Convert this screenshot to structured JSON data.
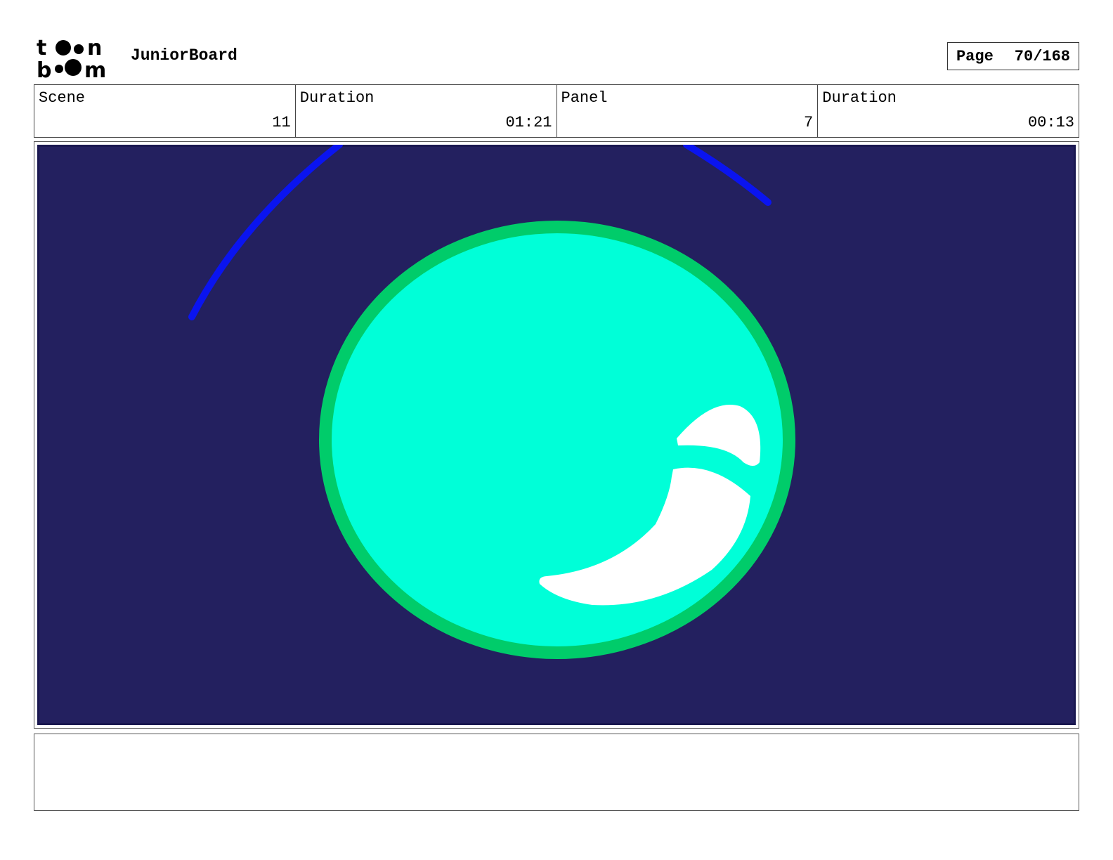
{
  "header": {
    "logo_top": "t●●n",
    "logo_bottom": "b●●m",
    "app_name": "JuniorBoard",
    "page_label": "Page",
    "page_value": "70/168"
  },
  "info": {
    "scene_label": "Scene",
    "scene_value": "11",
    "scene_duration_label": "Duration",
    "scene_duration_value": "01:21",
    "panel_label": "Panel",
    "panel_value": "7",
    "panel_duration_label": "Duration",
    "panel_duration_value": "00:13"
  },
  "panel_art": {
    "background_color": "#23205f",
    "arc_color": "#0a14f0",
    "circle_fill": "#00ffd8",
    "circle_stroke": "#00cc6a",
    "highlight_color": "#ffffff"
  },
  "notes": {
    "text": ""
  }
}
